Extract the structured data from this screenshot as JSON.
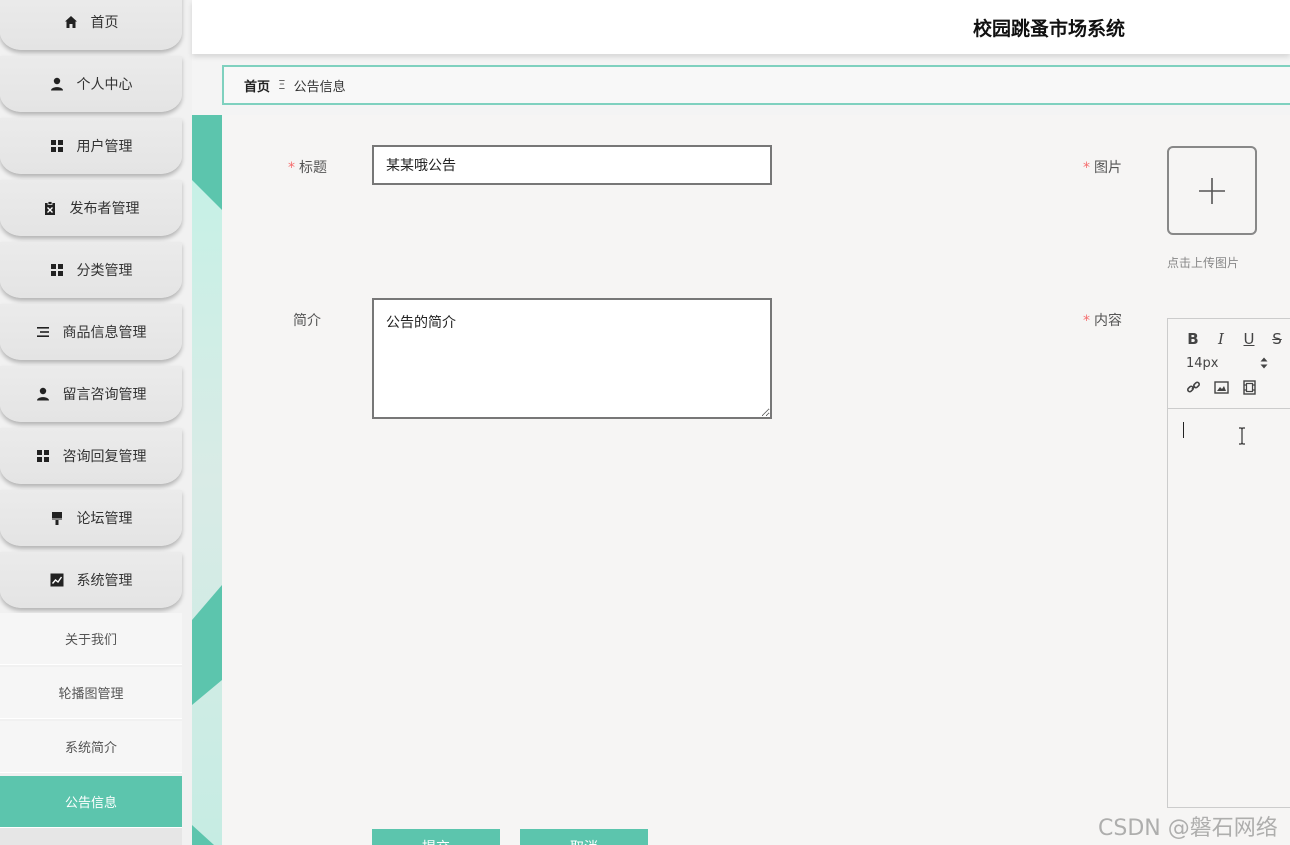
{
  "app_title": "校园跳蚤市场系统",
  "sidebar": {
    "menu": [
      {
        "label": "首页",
        "icon": "home-icon"
      },
      {
        "label": "个人中心",
        "icon": "user-icon"
      },
      {
        "label": "用户管理",
        "icon": "grid-icon"
      },
      {
        "label": "发布者管理",
        "icon": "clipboard-icon"
      },
      {
        "label": "分类管理",
        "icon": "grid-icon"
      },
      {
        "label": "商品信息管理",
        "icon": "list-icon"
      },
      {
        "label": "留言咨询管理",
        "icon": "user-icon"
      },
      {
        "label": "咨询回复管理",
        "icon": "grid-icon"
      },
      {
        "label": "论坛管理",
        "icon": "brush-icon"
      },
      {
        "label": "系统管理",
        "icon": "chart-icon"
      }
    ],
    "submenu": [
      {
        "label": "关于我们",
        "active": false
      },
      {
        "label": "轮播图管理",
        "active": false
      },
      {
        "label": "系统简介",
        "active": false
      },
      {
        "label": "公告信息",
        "active": true
      }
    ]
  },
  "breadcrumb": {
    "home": "首页",
    "separator": "Ξ",
    "current": "公告信息"
  },
  "form": {
    "title_label": "标题",
    "title_value": "某某哦公告",
    "image_label": "图片",
    "upload_hint": "点击上传图片",
    "intro_label": "简介",
    "intro_value": "公告的简介",
    "content_label": "内容",
    "required_mark": "*"
  },
  "editor": {
    "bold": "B",
    "italic": "I",
    "underline": "U",
    "strike": "S",
    "font_size": "14px"
  },
  "buttons": {
    "submit": "提交",
    "cancel": "取消"
  },
  "watermark": "CSDN @磐石网络",
  "colors": {
    "accent": "#5cc5ad",
    "required": "#f56c6c"
  }
}
